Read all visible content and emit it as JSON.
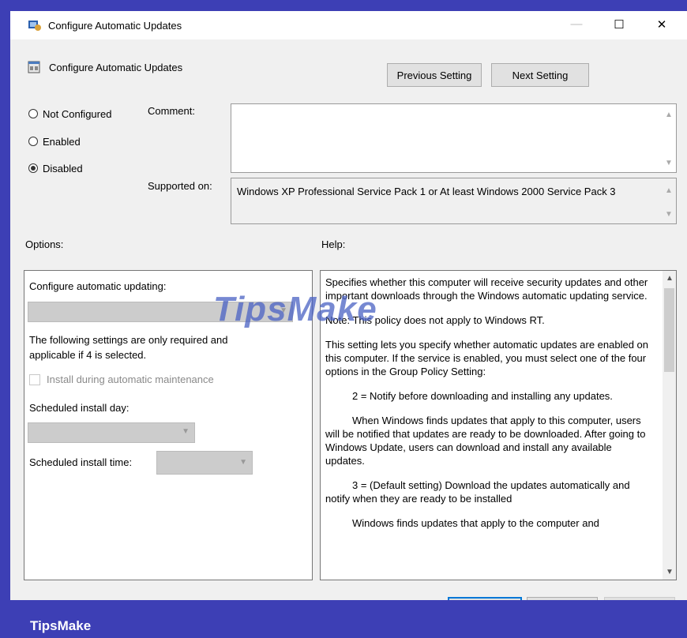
{
  "window": {
    "title": "Configure Automatic Updates",
    "controls": {
      "minimize": "—",
      "maximize": "☐",
      "close": "✕"
    }
  },
  "header": {
    "policy_name": "Configure Automatic Updates",
    "previous_label": "Previous Setting",
    "next_label": "Next Setting"
  },
  "state": {
    "options": [
      {
        "label": "Not Configured",
        "checked": false
      },
      {
        "label": "Enabled",
        "checked": false
      },
      {
        "label": "Disabled",
        "checked": true
      }
    ]
  },
  "comment": {
    "label": "Comment:",
    "value": ""
  },
  "supported": {
    "label": "Supported on:",
    "value": "Windows XP Professional Service Pack 1 or At least Windows 2000 Service Pack 3"
  },
  "options_panel": {
    "heading": "Options:",
    "configure_label": "Configure automatic updating:",
    "configure_value": "",
    "note": "The following settings are only required and applicable if 4 is selected.",
    "maintenance_label": "Install during automatic maintenance",
    "day_label": "Scheduled install day:",
    "day_value": "",
    "time_label": "Scheduled install time:",
    "time_value": ""
  },
  "help_panel": {
    "heading": "Help:",
    "paragraphs": [
      "Specifies whether this computer will receive security updates and other important downloads through the Windows automatic updating service.",
      "Note: This policy does not apply to Windows RT.",
      "This setting lets you specify whether automatic updates are enabled on this computer. If the service is enabled, you must select one of the four options in the Group Policy Setting:",
      "2 = Notify before downloading and installing any updates.",
      "When Windows finds updates that apply to this computer, users will be notified that updates are ready to be downloaded. After going to Windows Update, users can download and install any available updates.",
      "3 = (Default setting) Download the updates automatically and notify when they are ready to be installed",
      "Windows finds updates that apply to the computer and"
    ]
  },
  "watermark": "TipsMake",
  "brand": "TipsMake",
  "colors": {
    "background": "#3d3fb5",
    "dialog": "#f0f0f0",
    "accent": "#0078d7"
  }
}
